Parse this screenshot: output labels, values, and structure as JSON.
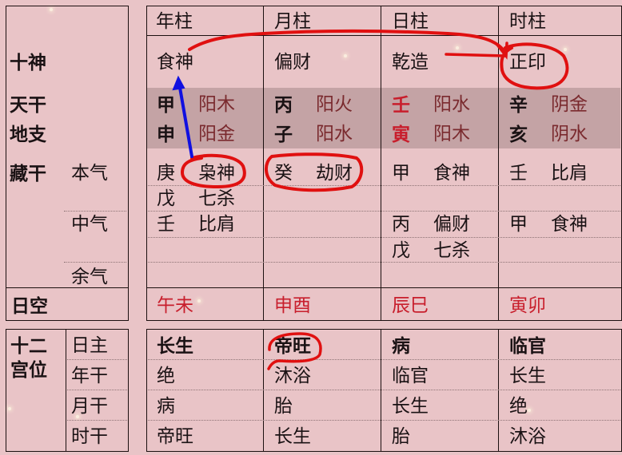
{
  "left_labels": {
    "ten_gods": "十神",
    "heavenly_stem": "天干",
    "earthly_branch": "地支",
    "hidden_stems": "藏干",
    "main_qi": "本气",
    "middle_qi": "中气",
    "residual_qi": "余气",
    "day_void": "日空",
    "twelve_palaces_1": "十二",
    "twelve_palaces_2": "宫位",
    "day_master": "日主",
    "year_stem": "年干",
    "month_stem": "月干",
    "hour_stem": "时干"
  },
  "pillars": [
    {
      "header": "年柱",
      "ten_god": "食神",
      "stem": "甲",
      "stem_element": "阳木",
      "branch": "申",
      "branch_element": "阳金",
      "hidden": [
        {
          "stem": "庚",
          "god": "枭神"
        },
        {
          "stem": "戊",
          "god": "七杀"
        },
        {
          "stem": "壬",
          "god": "比肩"
        }
      ],
      "void": "午未",
      "palaces": [
        "长生",
        "绝",
        "病",
        "帝旺"
      ]
    },
    {
      "header": "月柱",
      "ten_god": "偏财",
      "stem": "丙",
      "stem_element": "阳火",
      "branch": "子",
      "branch_element": "阳水",
      "hidden": [
        {
          "stem": "癸",
          "god": "劫财"
        }
      ],
      "void": "申酉",
      "palaces": [
        "帝旺",
        "沐浴",
        "胎",
        "长生"
      ]
    },
    {
      "header": "日柱",
      "ten_god": "乾造",
      "stem": "壬",
      "stem_element": "阳水",
      "branch": "寅",
      "branch_element": "阳木",
      "hidden": [
        {
          "stem": "甲",
          "god": "食神"
        },
        {
          "stem": "丙",
          "god": "偏财"
        },
        {
          "stem": "戊",
          "god": "七杀"
        }
      ],
      "void": "辰巳",
      "palaces": [
        "病",
        "临官",
        "长生",
        "胎"
      ]
    },
    {
      "header": "时柱",
      "ten_god": "正印",
      "stem": "辛",
      "stem_element": "阴金",
      "branch": "亥",
      "branch_element": "阴水",
      "hidden": [
        {
          "stem": "壬",
          "god": "比肩"
        },
        {
          "stem": "甲",
          "god": "食神"
        }
      ],
      "void": "寅卯",
      "palaces": [
        "临官",
        "长生",
        "绝",
        "沐浴"
      ]
    }
  ],
  "colors": {
    "background": "#e9c4c7",
    "shaded_row": "#c4a3a5",
    "void_text": "#c81e2c",
    "day_stem_text": "#c81e2c",
    "element_text": "#7a2a2e",
    "annotation_red": "#e01010",
    "annotation_blue": "#1010e0"
  }
}
